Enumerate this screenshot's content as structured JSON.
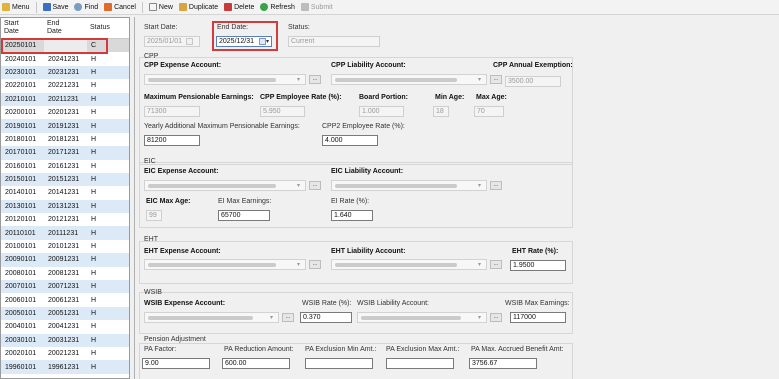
{
  "toolbar": {
    "menu": "Menu",
    "save": "Save",
    "find": "Find",
    "cancel": "Cancel",
    "new": "New",
    "duplicate": "Duplicate",
    "delete": "Delete",
    "refresh": "Refresh",
    "submit": "Submit"
  },
  "list": {
    "headers": {
      "start": "Start\nDate",
      "end": "End\nDate",
      "status": "Status"
    },
    "rows": [
      {
        "start": "20250101",
        "end": "",
        "status": "C"
      },
      {
        "start": "20240101",
        "end": "20241231",
        "status": "H"
      },
      {
        "start": "20230101",
        "end": "20231231",
        "status": "H"
      },
      {
        "start": "20220101",
        "end": "20221231",
        "status": "H"
      },
      {
        "start": "20210101",
        "end": "20211231",
        "status": "H"
      },
      {
        "start": "20200101",
        "end": "20201231",
        "status": "H"
      },
      {
        "start": "20190101",
        "end": "20191231",
        "status": "H"
      },
      {
        "start": "20180101",
        "end": "20181231",
        "status": "H"
      },
      {
        "start": "20170101",
        "end": "20171231",
        "status": "H"
      },
      {
        "start": "20160101",
        "end": "20161231",
        "status": "H"
      },
      {
        "start": "20150101",
        "end": "20151231",
        "status": "H"
      },
      {
        "start": "20140101",
        "end": "20141231",
        "status": "H"
      },
      {
        "start": "20130101",
        "end": "20131231",
        "status": "H"
      },
      {
        "start": "20120101",
        "end": "20121231",
        "status": "H"
      },
      {
        "start": "20110101",
        "end": "20111231",
        "status": "H"
      },
      {
        "start": "20100101",
        "end": "20101231",
        "status": "H"
      },
      {
        "start": "20090101",
        "end": "20091231",
        "status": "H"
      },
      {
        "start": "20080101",
        "end": "20081231",
        "status": "H"
      },
      {
        "start": "20070101",
        "end": "20071231",
        "status": "H"
      },
      {
        "start": "20060101",
        "end": "20061231",
        "status": "H"
      },
      {
        "start": "20050101",
        "end": "20051231",
        "status": "H"
      },
      {
        "start": "20040101",
        "end": "20041231",
        "status": "H"
      },
      {
        "start": "20030101",
        "end": "20031231",
        "status": "H"
      },
      {
        "start": "20020101",
        "end": "20021231",
        "status": "H"
      },
      {
        "start": "19960101",
        "end": "19961231",
        "status": "H"
      }
    ]
  },
  "header": {
    "start_label": "Start Date:",
    "start_value": "2025/01/01",
    "end_label": "End Date:",
    "end_value": "2025/12/31",
    "status_label": "Status:",
    "status_value": "Current"
  },
  "cpp": {
    "title": "CPP",
    "expense_label": "CPP Expense Account:",
    "liability_label": "CPP Liability Account:",
    "exemption_label": "CPP Annual Exemption:",
    "exemption_value": "3500.00",
    "max_earn_label": "Maximum Pensionable Earnings:",
    "max_earn_value": "71300",
    "emp_rate_label": "CPP Employee Rate (%):",
    "emp_rate_value": "5.950",
    "board_label": "Board Portion:",
    "board_value": "1.000",
    "min_age_label": "Min Age:",
    "min_age_value": "18",
    "max_age_label": "Max Age:",
    "max_age_value": "70",
    "add_max_label": "Yearly Additional Maximum Pensionable Earnings:",
    "add_max_value": "81200",
    "cpp2_label": "CPP2 Employee Rate (%):",
    "cpp2_value": "4.000"
  },
  "eic": {
    "title": "EIC",
    "expense_label": "EIC Expense Account:",
    "liability_label": "EIC Liability Account:",
    "max_age_label": "EIC Max Age:",
    "max_age_value": "99",
    "max_earn_label": "EI Max Earnings:",
    "max_earn_value": "65700",
    "rate_label": "EI Rate (%):",
    "rate_value": "1.640"
  },
  "eht": {
    "title": "EHT",
    "expense_label": "EHT Expense Account:",
    "liability_label": "EHT Liability Account:",
    "rate_label": "EHT Rate (%):",
    "rate_value": "1.9500"
  },
  "wsib": {
    "title": "WSIB",
    "expense_label": "WSIB Expense Account:",
    "rate_label": "WSIB Rate (%):",
    "rate_value": "0.370",
    "liability_label": "WSIB Liability Account:",
    "max_earn_label": "WSIB Max Earnings:",
    "max_earn_value": "117000"
  },
  "pension": {
    "title": "Pension Adjustment",
    "factor_label": "PA Factor:",
    "factor_value": "9.00",
    "reduction_label": "PA Reduction Amount:",
    "reduction_value": "600.00",
    "excl_min_label": "PA Exclusion Min Amt.:",
    "excl_min_value": "",
    "excl_max_label": "PA Exclusion Max Amt.:",
    "excl_max_value": "",
    "accrued_label": "PA Max. Accrued Benefit Amt:",
    "accrued_value": "3756.67"
  },
  "icons": [
    "menu-icon",
    "save-icon",
    "find-icon",
    "cancel-icon",
    "new-icon",
    "duplicate-icon",
    "delete-icon",
    "refresh-icon",
    "submit-icon",
    "calendar-icon",
    "dropdown-arrow-icon",
    "ellipsis-icon"
  ],
  "colors": {
    "highlight": "#d23b3b",
    "row_alt": "#dce9f6",
    "selected_row": "#d9d9d9"
  }
}
